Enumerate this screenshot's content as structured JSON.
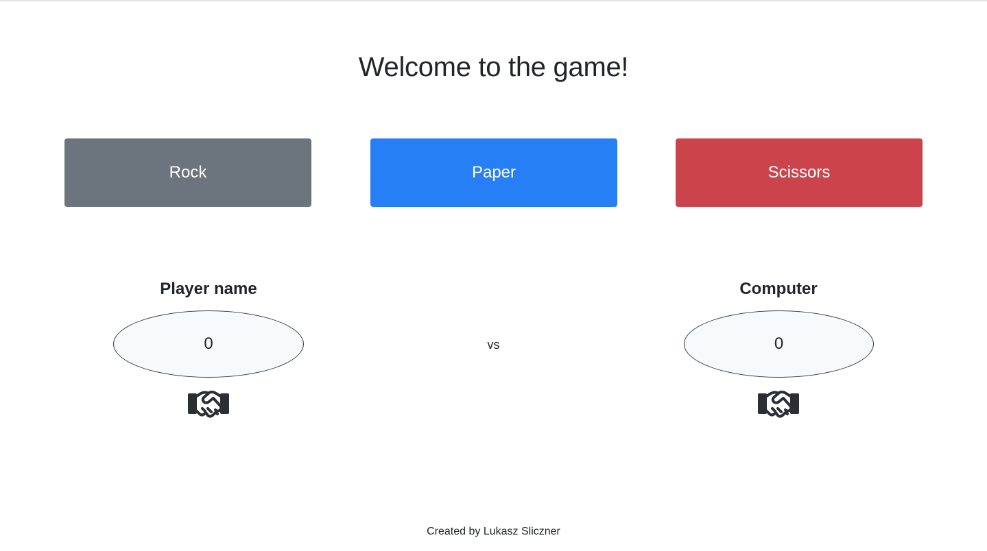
{
  "page": {
    "title": "Welcome to the game!"
  },
  "choices": {
    "rock_label": "Rock",
    "paper_label": "Paper",
    "scissors_label": "Scissors"
  },
  "colors": {
    "rock": "#6c757d",
    "paper": "#277ff6",
    "scissors": "#cc444b"
  },
  "player": {
    "name": "Player name",
    "score": "0",
    "icon": "handshake-icon"
  },
  "versus": {
    "label": "vs"
  },
  "computer": {
    "name": "Computer",
    "score": "0",
    "icon": "handshake-icon"
  },
  "footer": {
    "credit": "Created by Lukasz Sliczner"
  }
}
